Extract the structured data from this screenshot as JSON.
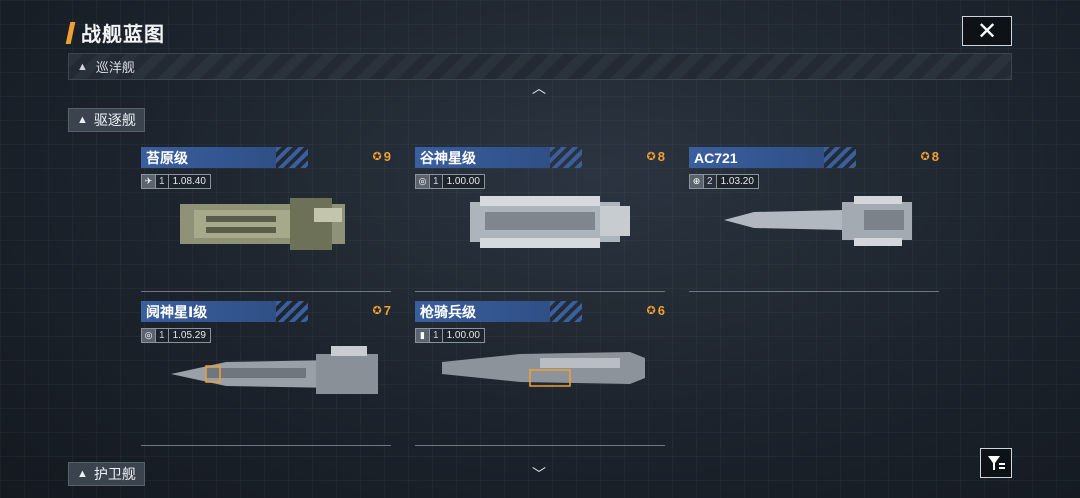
{
  "header": {
    "title": "战舰蓝图",
    "close_label": "✕"
  },
  "category_bar": {
    "label": "巡洋舰"
  },
  "sections": [
    {
      "label": "驱逐舰"
    },
    {
      "label": "护卫舰"
    }
  ],
  "ships": [
    {
      "name": "苔原级",
      "level": "9",
      "tier": "1",
      "version": "1.08.40",
      "icon": "jet-icon"
    },
    {
      "name": "谷神星级",
      "level": "8",
      "tier": "1",
      "version": "1.00.00",
      "icon": "target-icon"
    },
    {
      "name": "AC721",
      "level": "8",
      "tier": "2",
      "version": "1.03.20",
      "icon": "globe-icon"
    },
    {
      "name": "阋神星Ⅰ级",
      "level": "7",
      "tier": "1",
      "version": "1.05.29",
      "icon": "target-icon"
    },
    {
      "name": "枪骑兵级",
      "level": "6",
      "tier": "1",
      "version": "1.00.00",
      "icon": "missile-icon"
    }
  ],
  "colors": {
    "accent": "#f0a030",
    "name_bar": "#3a5f9e"
  }
}
